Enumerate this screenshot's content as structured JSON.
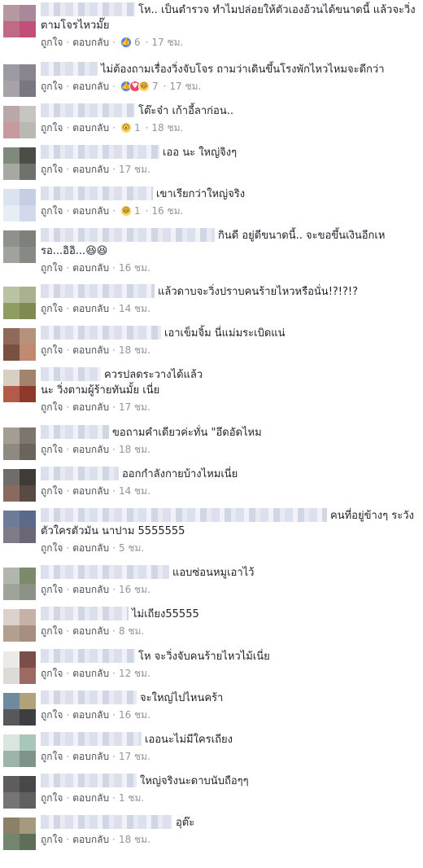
{
  "labels": {
    "like": "ถูกใจ",
    "reply": "ตอบกลับ",
    "sep": "·"
  },
  "colors": {
    "link": "#4b4f56",
    "meta": "#90949c",
    "text": "#1d2129",
    "like": "#4e82ef",
    "love": "#ed4560",
    "haha": "#fcd062"
  },
  "comments": [
    {
      "text": "โห.. เป็นตำรวจ ทำไมปล่อยให้ตัวเองอ้วนได้ขนาดนี้ แล้วจะวิ่งตามโจรไหวมั๊ย",
      "reactions": [
        "like-icon"
      ],
      "count": "6",
      "time": "17 ชม.",
      "avatar": [
        "#b49a9f",
        "#a9889a",
        "#c16a86",
        "#c24f79"
      ]
    },
    {
      "text": "ไม่ต้องถามเรื่องวิ่งจับโจร ถามว่าเดินขึ้นโรงพักไหวไหมจะดีกว่า",
      "reactions": [
        "like-icon",
        "love-icon",
        "haha-icon"
      ],
      "count": "7",
      "time": "17 ชม.",
      "avatar": [
        "#9d9aa3",
        "#8a8490",
        "#a7a1a8",
        "#7c7680"
      ]
    },
    {
      "text": "โต๊ะจ๋า เก้าอี้ลาก่อน..",
      "reactions": [
        "wow-icon"
      ],
      "count": "1",
      "time": "18 ชม.",
      "avatar": [
        "#b9a7a9",
        "#c7c5c2",
        "#c79aa0",
        "#bbb8b4"
      ]
    },
    {
      "text": "เออ นะ ใหญ่จิงๆ",
      "reactions": [],
      "count": "",
      "time": "17 ชม.",
      "avatar": [
        "#7f8a7c",
        "#4a4d48",
        "#a7a8a4",
        "#6e726c"
      ]
    },
    {
      "text": "เขาเรียกว่าใหญ่จริง",
      "reactions": [
        "haha-icon"
      ],
      "count": "1",
      "time": "16 ชม.",
      "avatar": [
        "#dbe2f0",
        "#c5cfe4",
        "#e8ecf5",
        "#d2d9ea"
      ]
    },
    {
      "text": "กินดี อยู่ดีขนาดนี้.. จะขอขึ้นเงินอีกเหรอ...อิอิ...😆😆",
      "reactions": [],
      "count": "",
      "time": "16 ชม.",
      "avatar": [
        "#8e918c",
        "#7d807b",
        "#9fa29d",
        "#868984"
      ]
    },
    {
      "text": "แล้วดาบจะวิ่งปราบคนร้ายไหวหรือนั่น!?!?!?",
      "reactions": [],
      "count": "",
      "time": "14 ชม.",
      "avatar": [
        "#b9c2a3",
        "#a8b290",
        "#8f9c62",
        "#7e8a52"
      ]
    },
    {
      "text": "เอาเข็มจิ้ม นี่แม่มระเบิดแน่",
      "reactions": [],
      "count": "",
      "time": "18 ชม.",
      "avatar": [
        "#8f6a58",
        "#b5927c",
        "#7a5040",
        "#c08a70"
      ]
    },
    {
      "text": "ควรปลดระวางได้แล้วนะ วิ่งตามผู้ร้ายทันมั้ย เนี่ย",
      "reactions": [],
      "count": "",
      "time": "17 ชม.",
      "avatar": [
        "#d8cfc3",
        "#a2846c",
        "#b45a4a",
        "#8c3a2c"
      ]
    },
    {
      "text": "ขอถามคำเดียวค่ะทั่น \"อึดอัดไหม",
      "reactions": [],
      "count": "",
      "time": "18 ชม.",
      "avatar": [
        "#a39d92",
        "#7c766c",
        "#8e8a82",
        "#6a655c"
      ]
    },
    {
      "text": "ออกกำลังกายบ้างไหมเนี่ย",
      "reactions": [],
      "count": "",
      "time": "14 ชม.",
      "avatar": [
        "#6f6c6a",
        "#3f3b38",
        "#8a6a5e",
        "#5a4a44"
      ]
    },
    {
      "text": "คนที่อยู่ข้างๆ ระวัง ตัวใครตัวมัน นาปาม 5555555",
      "reactions": [],
      "count": "",
      "time": "5 ชม.",
      "avatar": [
        "#6d7b99",
        "#5c6a8a",
        "#7f7b88",
        "#6a6676"
      ]
    },
    {
      "text": "แอบซ่อนหมูเอาไว้",
      "reactions": [],
      "count": "",
      "time": "16 ชม.",
      "avatar": [
        "#b2b7ae",
        "#7c8a6c",
        "#9ea498",
        "#8c9286"
      ]
    },
    {
      "text": "ไม่เถียง55555",
      "reactions": [],
      "count": "",
      "time": "8 ชม.",
      "avatar": [
        "#ddd2cb",
        "#c4b2a6",
        "#b49e8e",
        "#a88e7e"
      ]
    },
    {
      "text": "โห จะวิ่งจับคนร้ายไหวไม้เนี่ย",
      "reactions": [],
      "count": "",
      "time": "12 ชม.",
      "avatar": [
        "#eceae7",
        "#7a4e4a",
        "#dedad6",
        "#9c6a62"
      ]
    },
    {
      "text": "จะใหญ่ไปไหนคร้า",
      "reactions": [],
      "count": "",
      "time": "16 ชม.",
      "avatar": [
        "#6d8aa0",
        "#b2a27a",
        "#58585a",
        "#3c3e40"
      ]
    },
    {
      "text": "เออนะไม่มีใครเถียง",
      "reactions": [],
      "count": "",
      "time": "17 ชม.",
      "avatar": [
        "#d9e6df",
        "#a9c7b8",
        "#9fb4a8",
        "#7e9488"
      ]
    },
    {
      "text": "ใหญ่จริงนะดาบนับถือๆๆ",
      "reactions": [],
      "count": "",
      "time": "1 ชม.",
      "avatar": [
        "#5f5c5d",
        "#48484a",
        "#777474",
        "#606061"
      ]
    },
    {
      "text": "อุต๊ะ",
      "reactions": [],
      "count": "",
      "time": "18 ชม.",
      "avatar": [
        "#8c8066",
        "#a49a7e",
        "#72866e",
        "#5f6e58"
      ]
    }
  ]
}
